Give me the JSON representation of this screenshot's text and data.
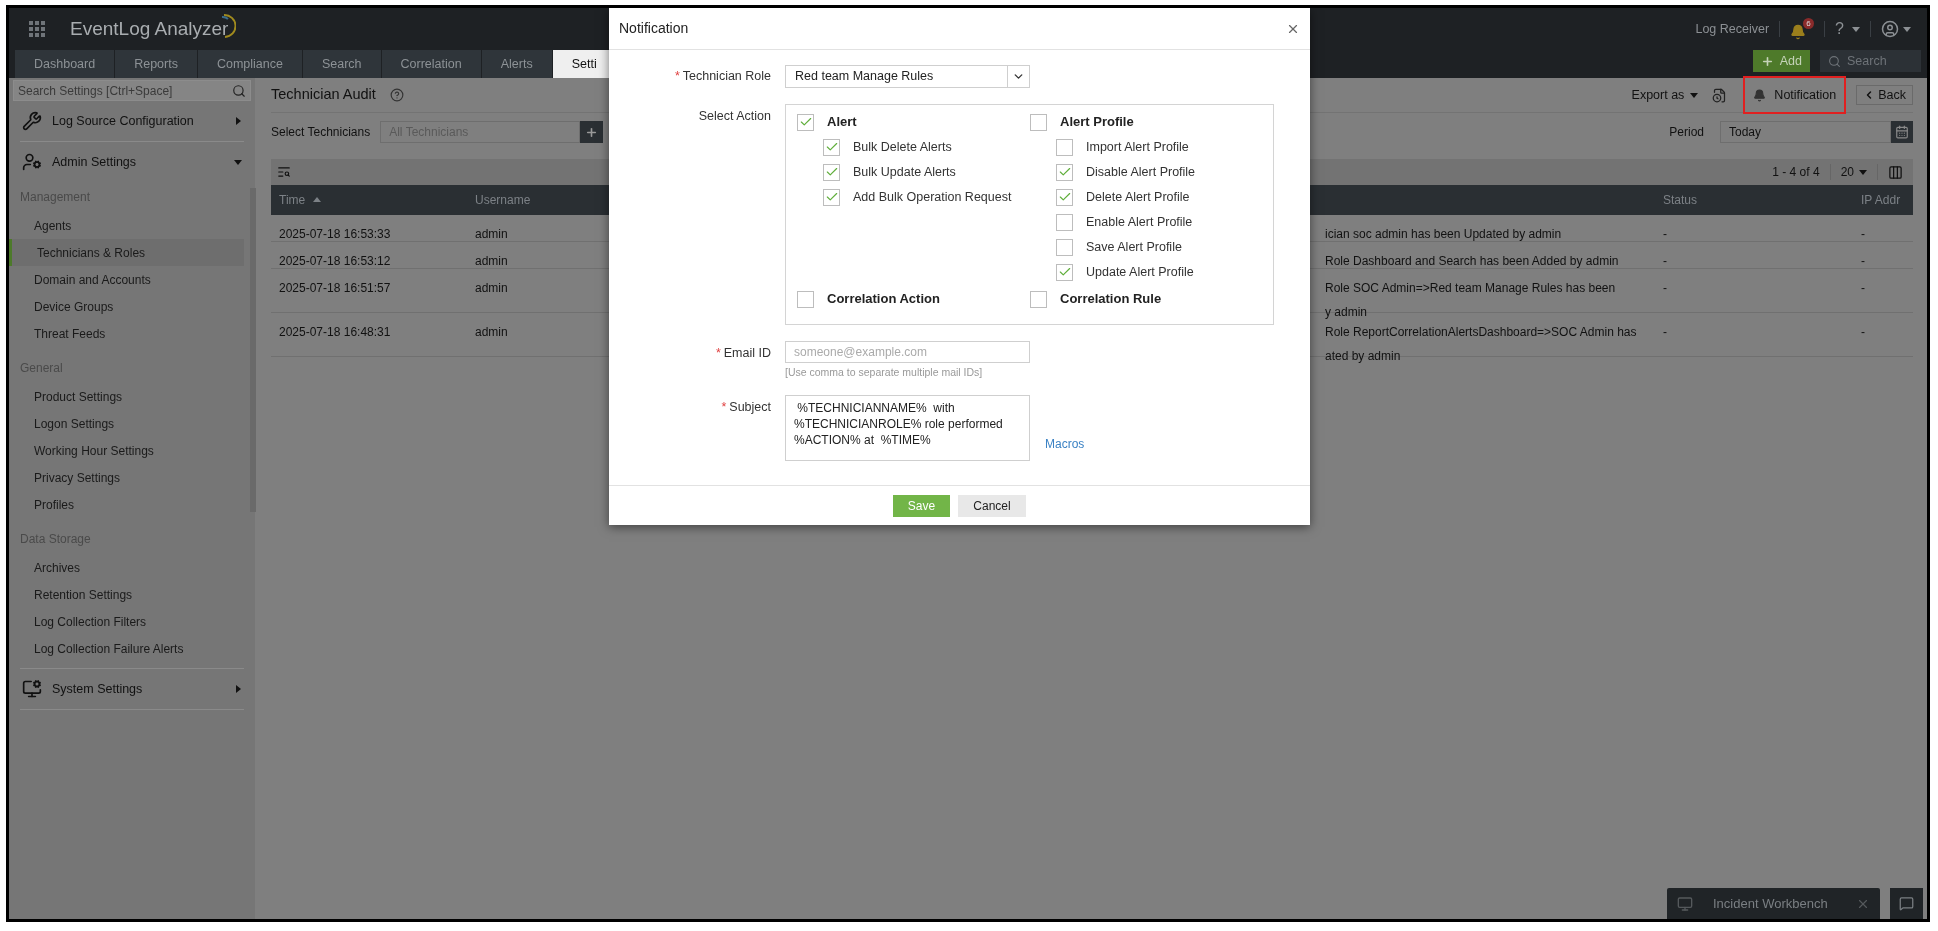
{
  "header": {
    "app_name": "EventLog Analyzer",
    "log_receiver": "Log Receiver",
    "alert_count": "6",
    "help": "?"
  },
  "tabs": [
    {
      "label": "Dashboard",
      "selected": false
    },
    {
      "label": "Reports",
      "selected": false
    },
    {
      "label": "Compliance",
      "selected": false
    },
    {
      "label": "Search",
      "selected": false
    },
    {
      "label": "Correlation",
      "selected": false
    },
    {
      "label": "Alerts",
      "selected": false
    },
    {
      "label": "Setti",
      "selected": true
    }
  ],
  "add_button": "Add",
  "global_search": {
    "placeholder": "Search"
  },
  "sidebar": {
    "search": {
      "placeholder": "Search Settings [Ctrl+Space]"
    },
    "groups": [
      {
        "label": "Log Source Configuration",
        "kind": "tools",
        "expanded": false
      },
      {
        "label": "Admin Settings",
        "kind": "admin",
        "expanded": true,
        "sections": [
          {
            "title": "Management",
            "items": [
              {
                "label": "Agents",
                "selected": false
              },
              {
                "label": "Technicians & Roles",
                "selected": true
              },
              {
                "label": "Domain and Accounts",
                "selected": false
              },
              {
                "label": "Device Groups",
                "selected": false
              },
              {
                "label": "Threat Feeds",
                "selected": false
              }
            ]
          },
          {
            "title": "General",
            "items": [
              {
                "label": "Product Settings",
                "selected": false
              },
              {
                "label": "Logon Settings",
                "selected": false
              },
              {
                "label": "Working Hour Settings",
                "selected": false
              },
              {
                "label": "Privacy Settings",
                "selected": false
              },
              {
                "label": "Profiles",
                "selected": false
              }
            ]
          },
          {
            "title": "Data Storage",
            "items": [
              {
                "label": "Archives",
                "selected": false
              },
              {
                "label": "Retention Settings",
                "selected": false
              },
              {
                "label": "Log Collection Filters",
                "selected": false
              },
              {
                "label": "Log Collection Failure Alerts",
                "selected": false
              }
            ]
          }
        ]
      },
      {
        "label": "System Settings",
        "kind": "system",
        "expanded": false
      }
    ]
  },
  "page": {
    "title": "Technician Audit",
    "export": "Export as",
    "notification": "Notification",
    "back": "Back",
    "technicians": {
      "label": "Select Technicians",
      "placeholder": "All Technicians"
    },
    "period": {
      "label": "Period",
      "value": "Today"
    },
    "pagination": "1 - 4 of 4",
    "page_size": "20"
  },
  "table": {
    "columns": [
      "Time",
      "Username",
      "",
      "Status",
      "IP Addr"
    ],
    "rows": [
      [
        "2025-07-18 16:53:33",
        "admin",
        "ician soc admin has been Updated by admin",
        "-",
        "-"
      ],
      [
        "2025-07-18 16:53:12",
        "admin",
        "Role Dashboard and Search has been Added by admin",
        "-",
        "-"
      ],
      [
        "2025-07-18 16:51:57",
        "admin",
        "Role SOC Admin=>Red team Manage Rules has been\ny admin",
        "-",
        "-"
      ],
      [
        "2025-07-18 16:48:31",
        "admin",
        "Role ReportCorrelationAlertsDashboard=>SOC Admin has\nated by admin",
        "-",
        "-"
      ]
    ]
  },
  "dialog": {
    "title": "Notification",
    "role": {
      "label": "Technician Role",
      "value": "Red team Manage Rules"
    },
    "action_label": "Select Action",
    "action_groups": [
      {
        "label": "Alert",
        "checked": true,
        "children": [
          {
            "label": "Bulk Delete Alerts",
            "checked": true
          },
          {
            "label": "Bulk Update Alerts",
            "checked": true
          },
          {
            "label": "Add Bulk Operation Request",
            "checked": true
          }
        ]
      },
      {
        "label": "Alert Profile",
        "checked": false,
        "children": [
          {
            "label": "Import Alert Profile",
            "checked": false
          },
          {
            "label": "Disable Alert Profile",
            "checked": true
          },
          {
            "label": "Delete Alert Profile",
            "checked": true
          },
          {
            "label": "Enable Alert Profile",
            "checked": false
          },
          {
            "label": "Save Alert Profile",
            "checked": false
          },
          {
            "label": "Update Alert Profile",
            "checked": true
          }
        ]
      },
      {
        "label": "Correlation Action",
        "checked": false
      },
      {
        "label": "Correlation Rule",
        "checked": false
      }
    ],
    "email": {
      "label": "Email ID",
      "placeholder": "someone@example.com",
      "hint": "[Use comma to separate multiple mail IDs]"
    },
    "subject": {
      "label": "Subject",
      "value": " %TECHNICIANNAME%  with\n%TECHNICIANROLE% role performed\n%ACTION% at  %TIME%"
    },
    "macros": "Macros",
    "required_mark": "*",
    "save": "Save",
    "cancel": "Cancel"
  },
  "incident_workbench": "Incident Workbench"
}
